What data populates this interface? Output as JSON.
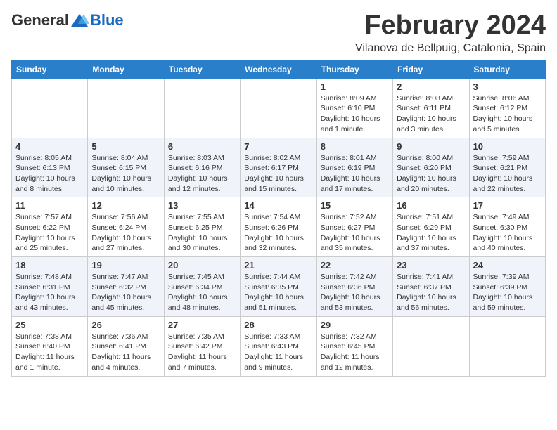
{
  "header": {
    "logo_general": "General",
    "logo_blue": "Blue",
    "month_title": "February 2024",
    "location": "Vilanova de Bellpuig, Catalonia, Spain"
  },
  "columns": [
    "Sunday",
    "Monday",
    "Tuesday",
    "Wednesday",
    "Thursday",
    "Friday",
    "Saturday"
  ],
  "weeks": [
    [
      {
        "day": "",
        "info": ""
      },
      {
        "day": "",
        "info": ""
      },
      {
        "day": "",
        "info": ""
      },
      {
        "day": "",
        "info": ""
      },
      {
        "day": "1",
        "info": "Sunrise: 8:09 AM\nSunset: 6:10 PM\nDaylight: 10 hours\nand 1 minute."
      },
      {
        "day": "2",
        "info": "Sunrise: 8:08 AM\nSunset: 6:11 PM\nDaylight: 10 hours\nand 3 minutes."
      },
      {
        "day": "3",
        "info": "Sunrise: 8:06 AM\nSunset: 6:12 PM\nDaylight: 10 hours\nand 5 minutes."
      }
    ],
    [
      {
        "day": "4",
        "info": "Sunrise: 8:05 AM\nSunset: 6:13 PM\nDaylight: 10 hours\nand 8 minutes."
      },
      {
        "day": "5",
        "info": "Sunrise: 8:04 AM\nSunset: 6:15 PM\nDaylight: 10 hours\nand 10 minutes."
      },
      {
        "day": "6",
        "info": "Sunrise: 8:03 AM\nSunset: 6:16 PM\nDaylight: 10 hours\nand 12 minutes."
      },
      {
        "day": "7",
        "info": "Sunrise: 8:02 AM\nSunset: 6:17 PM\nDaylight: 10 hours\nand 15 minutes."
      },
      {
        "day": "8",
        "info": "Sunrise: 8:01 AM\nSunset: 6:19 PM\nDaylight: 10 hours\nand 17 minutes."
      },
      {
        "day": "9",
        "info": "Sunrise: 8:00 AM\nSunset: 6:20 PM\nDaylight: 10 hours\nand 20 minutes."
      },
      {
        "day": "10",
        "info": "Sunrise: 7:59 AM\nSunset: 6:21 PM\nDaylight: 10 hours\nand 22 minutes."
      }
    ],
    [
      {
        "day": "11",
        "info": "Sunrise: 7:57 AM\nSunset: 6:22 PM\nDaylight: 10 hours\nand 25 minutes."
      },
      {
        "day": "12",
        "info": "Sunrise: 7:56 AM\nSunset: 6:24 PM\nDaylight: 10 hours\nand 27 minutes."
      },
      {
        "day": "13",
        "info": "Sunrise: 7:55 AM\nSunset: 6:25 PM\nDaylight: 10 hours\nand 30 minutes."
      },
      {
        "day": "14",
        "info": "Sunrise: 7:54 AM\nSunset: 6:26 PM\nDaylight: 10 hours\nand 32 minutes."
      },
      {
        "day": "15",
        "info": "Sunrise: 7:52 AM\nSunset: 6:27 PM\nDaylight: 10 hours\nand 35 minutes."
      },
      {
        "day": "16",
        "info": "Sunrise: 7:51 AM\nSunset: 6:29 PM\nDaylight: 10 hours\nand 37 minutes."
      },
      {
        "day": "17",
        "info": "Sunrise: 7:49 AM\nSunset: 6:30 PM\nDaylight: 10 hours\nand 40 minutes."
      }
    ],
    [
      {
        "day": "18",
        "info": "Sunrise: 7:48 AM\nSunset: 6:31 PM\nDaylight: 10 hours\nand 43 minutes."
      },
      {
        "day": "19",
        "info": "Sunrise: 7:47 AM\nSunset: 6:32 PM\nDaylight: 10 hours\nand 45 minutes."
      },
      {
        "day": "20",
        "info": "Sunrise: 7:45 AM\nSunset: 6:34 PM\nDaylight: 10 hours\nand 48 minutes."
      },
      {
        "day": "21",
        "info": "Sunrise: 7:44 AM\nSunset: 6:35 PM\nDaylight: 10 hours\nand 51 minutes."
      },
      {
        "day": "22",
        "info": "Sunrise: 7:42 AM\nSunset: 6:36 PM\nDaylight: 10 hours\nand 53 minutes."
      },
      {
        "day": "23",
        "info": "Sunrise: 7:41 AM\nSunset: 6:37 PM\nDaylight: 10 hours\nand 56 minutes."
      },
      {
        "day": "24",
        "info": "Sunrise: 7:39 AM\nSunset: 6:39 PM\nDaylight: 10 hours\nand 59 minutes."
      }
    ],
    [
      {
        "day": "25",
        "info": "Sunrise: 7:38 AM\nSunset: 6:40 PM\nDaylight: 11 hours\nand 1 minute."
      },
      {
        "day": "26",
        "info": "Sunrise: 7:36 AM\nSunset: 6:41 PM\nDaylight: 11 hours\nand 4 minutes."
      },
      {
        "day": "27",
        "info": "Sunrise: 7:35 AM\nSunset: 6:42 PM\nDaylight: 11 hours\nand 7 minutes."
      },
      {
        "day": "28",
        "info": "Sunrise: 7:33 AM\nSunset: 6:43 PM\nDaylight: 11 hours\nand 9 minutes."
      },
      {
        "day": "29",
        "info": "Sunrise: 7:32 AM\nSunset: 6:45 PM\nDaylight: 11 hours\nand 12 minutes."
      },
      {
        "day": "",
        "info": ""
      },
      {
        "day": "",
        "info": ""
      }
    ]
  ]
}
